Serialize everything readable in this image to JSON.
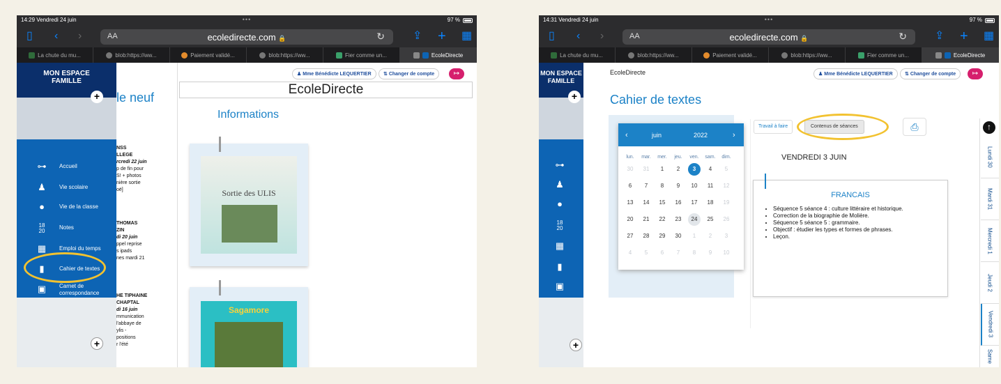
{
  "shotA": {
    "status": {
      "time": "14:29  Vendredi 24 juin",
      "battery": "97 %"
    },
    "url": {
      "aa": "AA",
      "domain": "ecoledirecte.com"
    },
    "tabs": [
      "La chute du mu...",
      "blob:https://ww...",
      "Paiement validé...",
      "blob:https://ww...",
      "Fier comme un...",
      "EcoleDirecte"
    ],
    "sidebar": {
      "title_line1": "MON ESPACE",
      "title_line2": "FAMILLE",
      "items": [
        "Accueil",
        "Vie scolaire",
        "Vie de la classe",
        "Notes",
        "Emploi du temps",
        "Cahier de textes",
        "Carnet de",
        "correspondance"
      ]
    },
    "account": {
      "user": "Mme Bénédicte LEQUERTIER",
      "switch": "Changer de compte"
    },
    "header": "EcoleDirecte",
    "news_heading_fragment": "le neuf",
    "info_title": "Informations",
    "news": [
      {
        "line1": "NSS",
        "line2": "LLEGE",
        "date": "rcredi 22 juin",
        "body": [
          "p de fin pour",
          "S! + photos",
          "nière sortie",
          "oë]"
        ]
      },
      {
        "line1": "THOMAS",
        "line2": "ZIN",
        "date": "di 20 juin",
        "body": [
          "ppel reprise",
          "s ipads",
          "nes mardi 21"
        ]
      },
      {
        "line1": "HE TIPHAINE",
        "line2": "CHAPTAL",
        "date": "di 16 juin",
        "body": [
          "mmunication",
          "l'abbaye de",
          "ylis -",
          "positions",
          "r l'été"
        ]
      }
    ],
    "posters": [
      "Sortie des ULIS",
      "Sagamore"
    ]
  },
  "shotB": {
    "status": {
      "time": "14:31  Vendredi 24 juin",
      "battery": "97 %"
    },
    "url": {
      "aa": "AA",
      "domain": "ecoledirecte.com"
    },
    "tabs": [
      "La chute du mu...",
      "blob:https://ww...",
      "Paiement validé...",
      "blob:https://ww...",
      "Fier comme un...",
      "EcoleDirecte"
    ],
    "sidebar": {
      "title_line1": "MON ESPACE",
      "title_line2": "FAMILLE"
    },
    "breadcrumb": "EcoleDirecte",
    "account": {
      "user": "Mme Bénédicte LEQUERTIER",
      "switch": "Changer de compte"
    },
    "page_title": "Cahier de textes",
    "calendar": {
      "prev": "‹",
      "next": "›",
      "month": "juin",
      "year": "2022",
      "weekdays": [
        "lun.",
        "mar.",
        "mer.",
        "jeu.",
        "ven.",
        "sam.",
        "dim."
      ],
      "rows": [
        [
          "30",
          "31",
          "1",
          "2",
          "3",
          "4",
          "5"
        ],
        [
          "6",
          "7",
          "8",
          "9",
          "10",
          "11",
          "12"
        ],
        [
          "13",
          "14",
          "15",
          "16",
          "17",
          "18",
          "19"
        ],
        [
          "20",
          "21",
          "22",
          "23",
          "24",
          "25",
          "26"
        ],
        [
          "27",
          "28",
          "29",
          "30",
          "1",
          "2",
          "3"
        ],
        [
          "4",
          "5",
          "6",
          "7",
          "8",
          "9",
          "10"
        ]
      ],
      "selected": "3",
      "today": "24"
    },
    "tabs_content": {
      "todo": "Travail à faire",
      "sessions": "Contenus de séances"
    },
    "day_title": "VENDREDI 3 JUIN",
    "subject": "FRANCAIS",
    "items": [
      "Séquence 5 séance 4 : culture littéraire et historique.",
      "Correction de la biographie de Molière.",
      "Séquence 5 séance 5 : grammaire.",
      "Objectif : étudier les types et formes de phrases.",
      "Leçon."
    ],
    "days": [
      "Lundi 30",
      "Mardi 31",
      "Mercredi 1",
      "Jeudi 2",
      "Vendredi 3",
      "Same"
    ]
  },
  "colors": {
    "accent": "#0d64b4",
    "highlight": "#f2c230",
    "logout": "#d61f6d"
  }
}
